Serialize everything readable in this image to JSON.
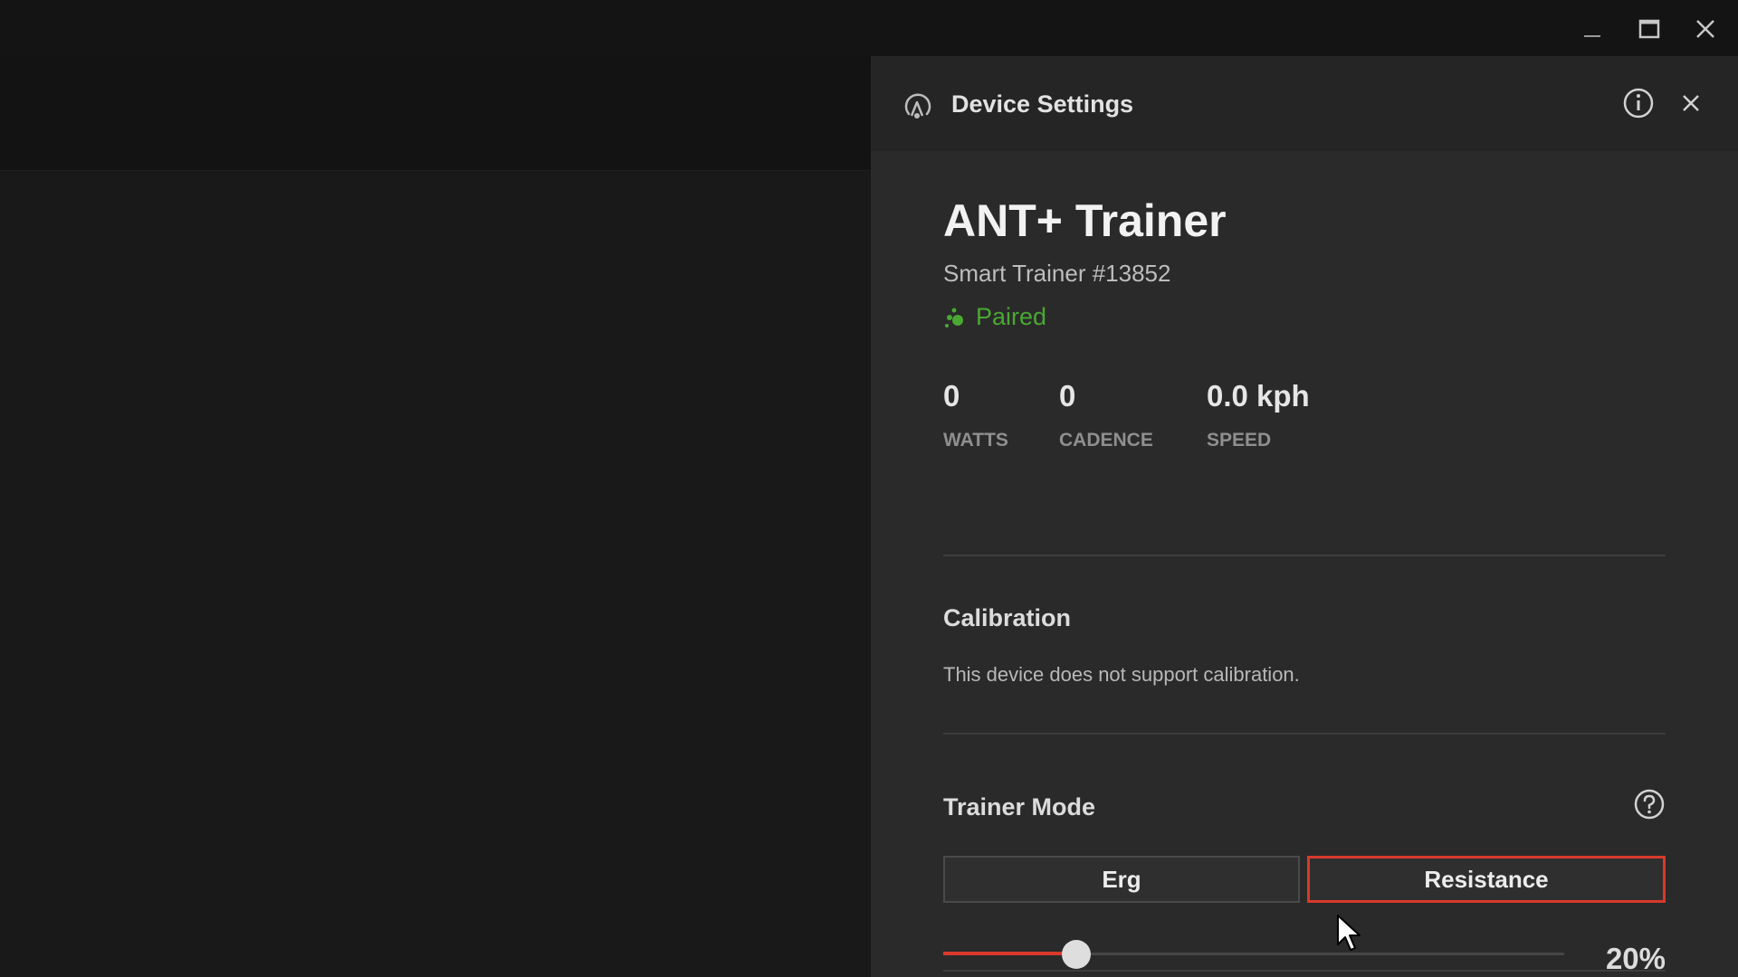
{
  "window": {
    "controls": {
      "minimize_icon": "minimize-icon",
      "maximize_icon": "maximize-icon",
      "close_icon": "close-icon"
    }
  },
  "panel": {
    "title": "Device Settings",
    "header_icon": "trainer-device-icon",
    "info_icon": "info-icon",
    "close_icon": "close-icon"
  },
  "device": {
    "name": "ANT+ Trainer",
    "subtitle": "Smart Trainer #13852",
    "status": "Paired",
    "status_icon": "paired-icon",
    "status_color": "#4aa832"
  },
  "stats": [
    {
      "value": "0",
      "label": "WATTS"
    },
    {
      "value": "0",
      "label": "CADENCE"
    },
    {
      "value": "0.0 kph",
      "label": "SPEED"
    }
  ],
  "calibration": {
    "title": "Calibration",
    "text": "This device does not support calibration."
  },
  "trainer_mode": {
    "title": "Trainer Mode",
    "help_icon": "help-icon",
    "options": [
      "Erg",
      "Resistance"
    ],
    "selected": "Resistance",
    "accent_color": "#d8392b",
    "resistance_percent": 20,
    "resistance_label": "20%"
  }
}
